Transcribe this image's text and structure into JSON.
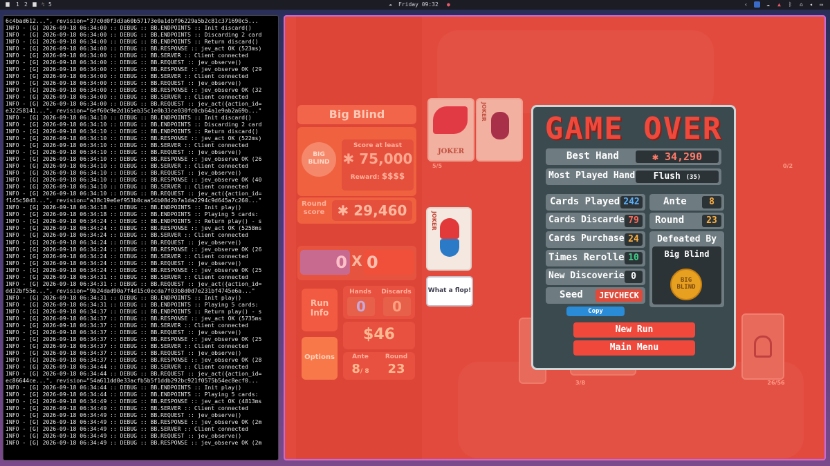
{
  "topbar": {
    "workspaces": [
      "1",
      "2",
      "4",
      "5"
    ],
    "clock": "Friday 09:32"
  },
  "terminal": {
    "lines": [
      "6c4bad612...\", revision=\"37c0d0f3d3a60b57173e0a1dbf96229a5b2c81c371690c5...",
      "INFO - [G] 2026-09-18 06:34:00 :: DEBUG :: BB.ENDPOINTS :: Init discard()",
      "INFO - [G] 2026-09-18 06:34:00 :: DEBUG :: BB.ENDPOINTS :: Discarding 2 card",
      "INFO - [G] 2026-09-18 06:34:00 :: DEBUG :: BB.ENDPOINTS :: Return discard()",
      "INFO - [G] 2026-09-18 06:34:00 :: DEBUG :: BB.RESPONSE :: jev_act OK (523ms)",
      "INFO - [G] 2026-09-18 06:34:00 :: DEBUG :: BB.SERVER :: Client connected",
      "INFO - [G] 2026-09-18 06:34:00 :: DEBUG :: BB.REQUEST :: jev_observe()",
      "INFO - [G] 2026-09-18 06:34:00 :: DEBUG :: BB.RESPONSE :: jev_observe OK (29",
      "INFO - [G] 2026-09-18 06:34:00 :: DEBUG :: BB.SERVER :: Client connected",
      "INFO - [G] 2026-09-18 06:34:00 :: DEBUG :: BB.REQUEST :: jev_observe()",
      "INFO - [G] 2026-09-18 06:34:00 :: DEBUG :: BB.RESPONSE :: jev_observe OK (32",
      "INFO - [G] 2026-09-18 06:34:00 :: DEBUG :: BB.SERVER :: Client connected",
      "INFO - [G] 2026-09-18 06:34:00 :: DEBUG :: BB.REQUEST :: jev_act({action_id=",
      "e32258141...\", revision=\"6ef60c9e2d165eb35c1e0b33ce030fc0cb64a1e9ab2a69b...\"",
      "INFO - [G] 2026-09-18 06:34:10 :: DEBUG :: BB.ENDPOINTS :: Init discard()",
      "INFO - [G] 2026-09-18 06:34:10 :: DEBUG :: BB.ENDPOINTS :: Discarding 2 card",
      "INFO - [G] 2026-09-18 06:34:10 :: DEBUG :: BB.ENDPOINTS :: Return discard()",
      "INFO - [G] 2026-09-18 06:34:10 :: DEBUG :: BB.RESPONSE :: jev_act OK (522ms)",
      "INFO - [G] 2026-09-18 06:34:10 :: DEBUG :: BB.SERVER :: Client connected",
      "INFO - [G] 2026-09-18 06:34:10 :: DEBUG :: BB.REQUEST :: jev_observe()",
      "INFO - [G] 2026-09-18 06:34:10 :: DEBUG :: BB.RESPONSE :: jev_observe OK (26",
      "INFO - [G] 2026-09-18 06:34:10 :: DEBUG :: BB.SERVER :: Client connected",
      "INFO - [G] 2026-09-18 06:34:10 :: DEBUG :: BB.REQUEST :: jev_observe()",
      "INFO - [G] 2026-09-18 06:34:10 :: DEBUG :: BB.RESPONSE :: jev_observe OK (40",
      "INFO - [G] 2026-09-18 06:34:10 :: DEBUG :: BB.SERVER :: Client connected",
      "INFO - [G] 2026-09-18 06:34:10 :: DEBUG :: BB.REQUEST :: jev_act({action_id=",
      "f145c50d3...\", revision=\"a38c19e6ef953b0caa54b08d2b7a1da2294c9d645a7c260...\"",
      "INFO - [G] 2026-09-18 06:34:18 :: DEBUG :: BB.ENDPOINTS :: Init play()",
      "INFO - [G] 2026-09-18 06:34:18 :: DEBUG :: BB.ENDPOINTS :: Playing 5 cards:",
      "INFO - [G] 2026-09-18 06:34:24 :: DEBUG :: BB.ENDPOINTS :: Return play() - s",
      "INFO - [G] 2026-09-18 06:34:24 :: DEBUG :: BB.RESPONSE :: jev_act OK (5258ms",
      "INFO - [G] 2026-09-18 06:34:24 :: DEBUG :: BB.SERVER :: Client connected",
      "INFO - [G] 2026-09-18 06:34:24 :: DEBUG :: BB.REQUEST :: jev_observe()",
      "INFO - [G] 2026-09-18 06:34:24 :: DEBUG :: BB.RESPONSE :: jev_observe OK (26",
      "INFO - [G] 2026-09-18 06:34:24 :: DEBUG :: BB.SERVER :: Client connected",
      "INFO - [G] 2026-09-18 06:34:24 :: DEBUG :: BB.REQUEST :: jev_observe()",
      "INFO - [G] 2026-09-18 06:34:24 :: DEBUG :: BB.RESPONSE :: jev_observe OK (25",
      "INFO - [G] 2026-09-18 06:34:31 :: DEBUG :: BB.SERVER :: Client connected",
      "INFO - [G] 2026-09-18 06:34:31 :: DEBUG :: BB.REQUEST :: jev_act({action_id=",
      "dd32bf55e...\", revision=\"9b24dad90a7f4d15c0ecda7f03b8d0d7e231bf4745e6a...\"",
      "INFO - [G] 2026-09-18 06:34:31 :: DEBUG :: BB.ENDPOINTS :: Init play()",
      "INFO - [G] 2026-09-18 06:34:31 :: DEBUG :: BB.ENDPOINTS :: Playing 5 cards:",
      "INFO - [G] 2026-09-18 06:34:37 :: DEBUG :: BB.ENDPOINTS :: Return play() - s",
      "INFO - [G] 2026-09-18 06:34:37 :: DEBUG :: BB.RESPONSE :: jev_act OK (5735ms",
      "INFO - [G] 2026-09-18 06:34:37 :: DEBUG :: BB.SERVER :: Client connected",
      "INFO - [G] 2026-09-18 06:34:37 :: DEBUG :: BB.REQUEST :: jev_observe()",
      "INFO - [G] 2026-09-18 06:34:37 :: DEBUG :: BB.RESPONSE :: jev_observe OK (25",
      "INFO - [G] 2026-09-18 06:34:37 :: DEBUG :: BB.SERVER :: Client connected",
      "INFO - [G] 2026-09-18 06:34:37 :: DEBUG :: BB.REQUEST :: jev_observe()",
      "INFO - [G] 2026-09-18 06:34:37 :: DEBUG :: BB.RESPONSE :: jev_observe OK (28",
      "INFO - [G] 2026-09-18 06:34:44 :: DEBUG :: BB.SERVER :: Client connected",
      "INFO - [G] 2026-09-18 06:34:44 :: DEBUG :: BB.REQUEST :: jev_act({action_id=",
      "ec86644ce...\", revision=\"54a611dd0e33acfb5b5f1ddb292bc921f0575b54ec8ecf0...",
      "INFO - [G] 2026-09-18 06:34:44 :: DEBUG :: BB.ENDPOINTS :: Init play()",
      "INFO - [G] 2026-09-18 06:34:44 :: DEBUG :: BB.ENDPOINTS :: Playing 5 cards:",
      "INFO - [G] 2026-09-18 06:34:49 :: DEBUG :: BB.RESPONSE :: jev_act OK (4813ms",
      "INFO - [G] 2026-09-18 06:34:49 :: DEBUG :: BB.SERVER :: Client connected",
      "INFO - [G] 2026-09-18 06:34:49 :: DEBUG :: BB.REQUEST :: jev_observe()",
      "INFO - [G] 2026-09-18 06:34:49 :: DEBUG :: BB.RESPONSE :: jev_observe OK (2m",
      "INFO - [G] 2026-09-18 06:34:49 :: DEBUG :: BB.SERVER :: Client connected",
      "INFO - [G] 2026-09-18 06:34:49 :: DEBUG :: BB.REQUEST :: jev_observe()",
      "INFO - [G] 2026-09-18 06:34:49 :: DEBUG :: BB.RESPONSE :: jev_observe OK (2m"
    ]
  },
  "left_panel": {
    "blind_name": "Big Blind",
    "blind_chip": "BIG BLIND",
    "score_at_least_label": "Score at least",
    "score_target": "75,000",
    "reward_label": "Reward:",
    "reward_value": "$$$$",
    "round_score_label": "Round score",
    "round_score": "29,460",
    "chips": "0",
    "mult": "0",
    "times": "X",
    "run_info": "Run Info",
    "options": "Options",
    "hands_label": "Hands",
    "hands": "0",
    "discards_label": "Discards",
    "discards": "0",
    "money": "$46",
    "ante_label": "Ante",
    "ante": "8",
    "ante_max": "/ 8",
    "round_label": "Round",
    "round": "23"
  },
  "board": {
    "joker_slots": "5/5",
    "consumable_slots": "0/2",
    "hand_count": "3/8",
    "deck_count": "26/56",
    "joker_label": "JOKER",
    "speech": "What a flop!"
  },
  "game_over": {
    "title": "GAME OVER",
    "best_hand_label": "Best Hand",
    "best_hand": "34,290",
    "most_played_label": "Most Played Hand",
    "most_played": "Flush",
    "most_played_count": "(35)",
    "cards_played_label": "Cards Played",
    "cards_played": "242",
    "cards_discarded_label": "Cards Discarded",
    "cards_discarded": "79",
    "cards_purchased_label": "Cards Purchased",
    "cards_purchased": "24",
    "times_rerolled_label": "Times Rerolled",
    "times_rerolled": "10",
    "new_discoveries_label": "New Discoveries",
    "new_discoveries": "0",
    "seed_label": "Seed",
    "seed": "JEVCHECK",
    "copy": "Copy",
    "ante_label": "Ante",
    "ante": "8",
    "round_label": "Round",
    "round": "23",
    "defeated_by_label": "Defeated By",
    "defeated_by": "Big Blind",
    "defeated_chip": "BIG BLIND",
    "new_run": "New Run",
    "main_menu": "Main Menu"
  },
  "colors": {
    "game_bg": "#e24a3d",
    "panel_bg": "#3b4a4f",
    "accent_red": "#f0493c",
    "blue_val": "#2a8bd6",
    "orange_val": "#e0962a",
    "green_val": "#2aa86a"
  }
}
